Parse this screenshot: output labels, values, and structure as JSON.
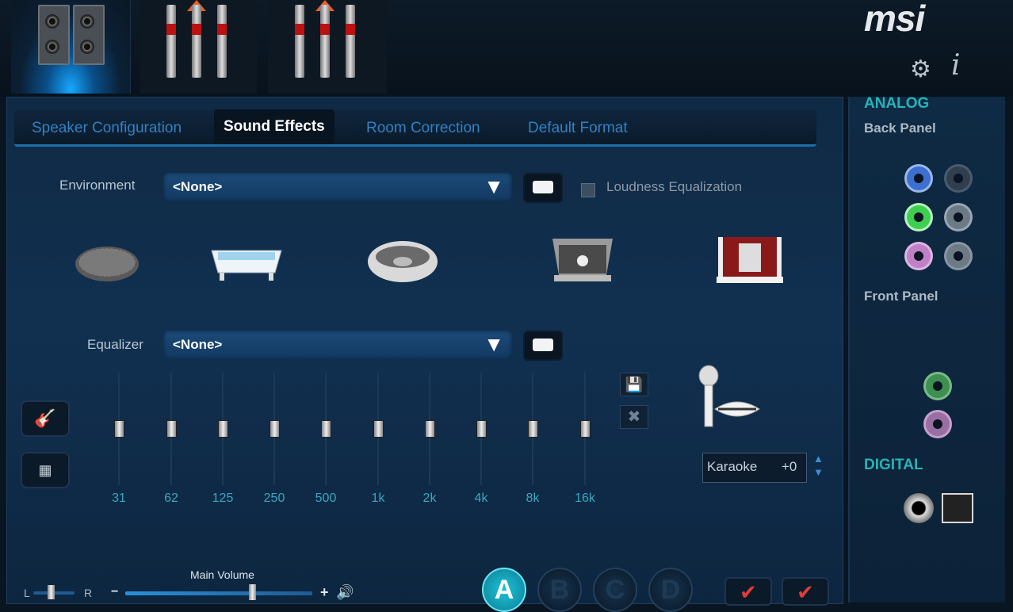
{
  "brand": {
    "logo_text": "msi"
  },
  "header": {
    "icons": [
      "gear-icon",
      "info-icon"
    ]
  },
  "tabs": [
    {
      "label": "Speaker Configuration",
      "active": false
    },
    {
      "label": "Sound Effects",
      "active": true
    },
    {
      "label": "Room Correction",
      "active": false
    },
    {
      "label": "Default Format",
      "active": false
    }
  ],
  "environment": {
    "label": "Environment",
    "selected": "<None>",
    "loudness_label": "Loudness Equalization",
    "presets_icons": [
      "stone-room-icon",
      "bathtub-icon",
      "stadium-icon",
      "stage-icon",
      "theater-icon"
    ]
  },
  "equalizer": {
    "label": "Equalizer",
    "selected": "<None>",
    "bands": [
      "31",
      "62",
      "125",
      "250",
      "500",
      "1k",
      "2k",
      "4k",
      "8k",
      "16k"
    ]
  },
  "karaoke": {
    "label": "Karaoke",
    "value": "+0"
  },
  "volume": {
    "label": "Main Volume",
    "balance_left": "L",
    "balance_right": "R",
    "minus": "−",
    "plus": "+"
  },
  "profiles": [
    "A",
    "B",
    "C",
    "D"
  ],
  "right_panel": {
    "analog_heading": "ANALOG",
    "back_panel": "Back Panel",
    "front_panel": "Front Panel",
    "digital_heading": "DIGITAL",
    "colors": {
      "blue": "#3c6fd0",
      "green": "#3fcf50",
      "pink": "#c080c8",
      "grey": "#6c7a86",
      "accent": "#27b3b7"
    }
  }
}
